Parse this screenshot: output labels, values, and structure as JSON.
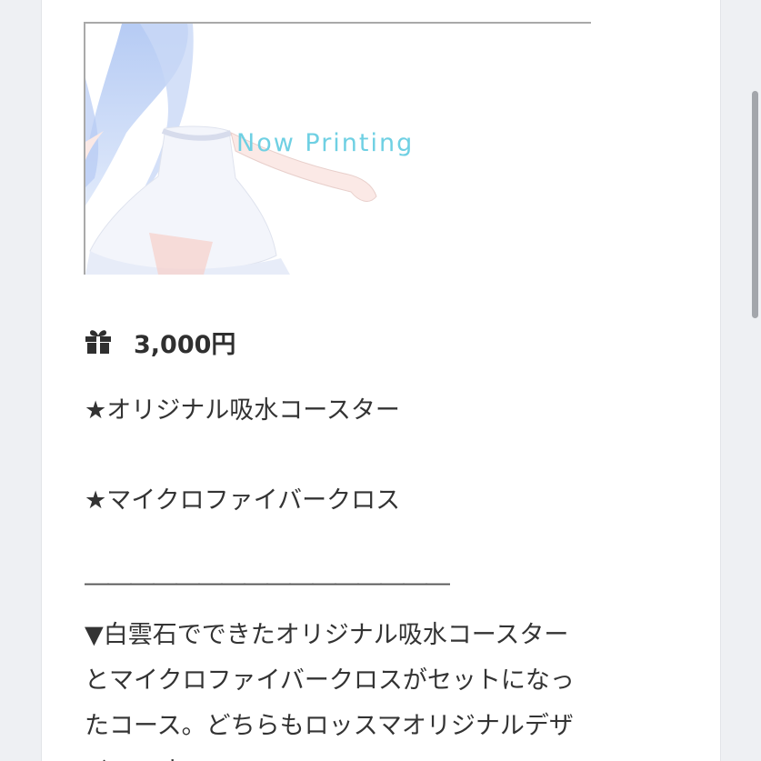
{
  "product": {
    "image_caption": "Now Printing",
    "price_icon": "gift-icon",
    "price": "3,000円"
  },
  "content": {
    "line1": "★オリジナル吸水コースター",
    "line2": "★マイクロファイバークロス",
    "separator": "――――――――――――――――",
    "paragraph": [
      "▼白雲石でできたオリジナル吸水コースター",
      "とマイクロファイバークロスがセットになっ",
      "たコース。どちらもロッスマオリジナルデザ",
      "インです。"
    ]
  },
  "colors": {
    "text": "#333333",
    "caption": "#6fd0e3",
    "hair": "#b9cdf0",
    "scrollbar": "#a3a6ab"
  }
}
